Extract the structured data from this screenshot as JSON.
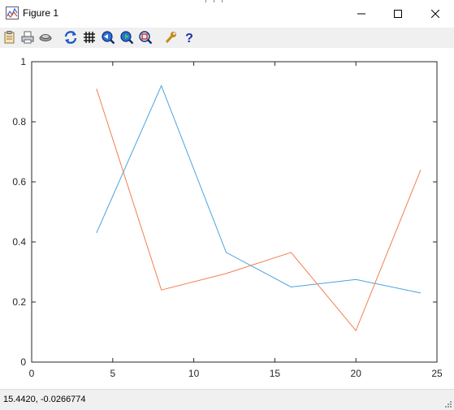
{
  "window": {
    "title": "Figure 1"
  },
  "toolbar": {
    "buttons": [
      {
        "name": "copy-icon"
      },
      {
        "name": "print-icon"
      },
      {
        "name": "rotate-view-icon"
      },
      {
        "name": "refresh-axes-icon"
      },
      {
        "name": "grid-toggle-icon"
      },
      {
        "name": "zoom-in-icon"
      },
      {
        "name": "zoom-out-icon"
      },
      {
        "name": "zoom-box-icon"
      },
      {
        "name": "properties-wrench-icon"
      },
      {
        "name": "help-icon"
      }
    ]
  },
  "chart_data": {
    "type": "line",
    "title": "",
    "xlabel": "",
    "ylabel": "",
    "xlim": [
      0,
      25
    ],
    "ylim": [
      0,
      1
    ],
    "xticks": [
      0,
      5,
      10,
      15,
      20,
      25
    ],
    "yticks": [
      0,
      0.2,
      0.4,
      0.6,
      0.8,
      1
    ],
    "xtick_labels": [
      "0",
      "5",
      "10",
      "15",
      "20",
      "25"
    ],
    "ytick_labels": [
      "0",
      "0.2",
      "0.4",
      "0.6",
      "0.8",
      "1"
    ],
    "grid": false,
    "series": [
      {
        "color": "#4aa3df",
        "x": [
          4,
          8,
          12,
          16,
          20,
          24
        ],
        "y": [
          0.43,
          0.92,
          0.365,
          0.25,
          0.275,
          0.23
        ]
      },
      {
        "color": "#f07f4f",
        "x": [
          4,
          8,
          12,
          16,
          20,
          24
        ],
        "y": [
          0.91,
          0.24,
          0.295,
          0.365,
          0.105,
          0.64
        ]
      }
    ]
  },
  "status": {
    "coords": "15.4420, -0.0266774"
  }
}
